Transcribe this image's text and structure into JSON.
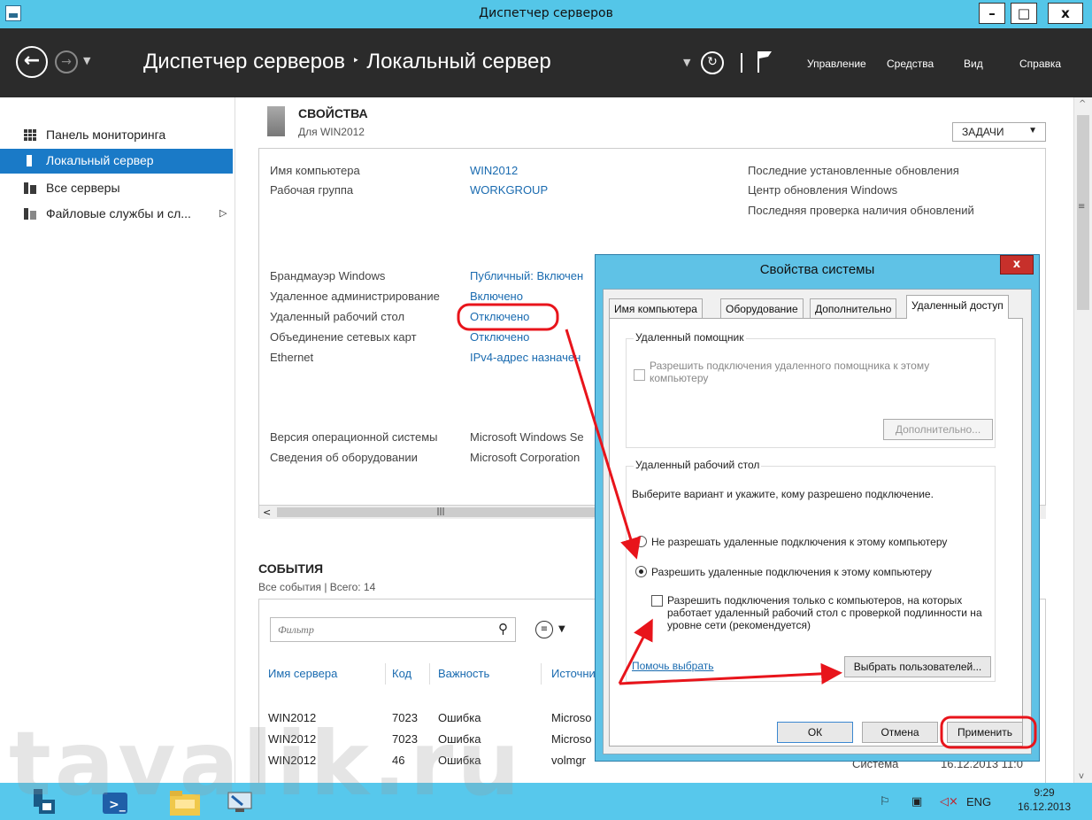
{
  "window": {
    "title": "Диспетчер серверов",
    "minimize": "–",
    "maximize": "□",
    "close": "x"
  },
  "header": {
    "breadcrumb_root": "Диспетчер серверов",
    "breadcrumb_sep": "‣",
    "breadcrumb_page": "Локальный сервер",
    "menu": [
      "Управление",
      "Средства",
      "Вид",
      "Справка"
    ]
  },
  "sidebar": {
    "items": [
      {
        "label": "Панель мониторинга"
      },
      {
        "label": "Локальный сервер"
      },
      {
        "label": "Все серверы"
      },
      {
        "label": "Файловые службы и сл..."
      }
    ]
  },
  "properties": {
    "title": "СВОЙСТВА",
    "subtitle": "Для WIN2012",
    "tasks": "ЗАДАЧИ",
    "rows1": [
      {
        "label": "Имя компьютера",
        "value": "WIN2012"
      },
      {
        "label": "Рабочая группа",
        "value": "WORKGROUP"
      }
    ],
    "right_labels": [
      "Последние установленные обновления",
      "Центр обновления Windows",
      "Последняя проверка наличия обновлений"
    ],
    "rows2": [
      {
        "label": "Брандмауэр Windows",
        "value": "Публичный: Включен"
      },
      {
        "label": "Удаленное администрирование",
        "value": "Включено"
      },
      {
        "label": "Удаленный рабочий стол",
        "value": "Отключено"
      },
      {
        "label": "Объединение сетевых карт",
        "value": "Отключено"
      },
      {
        "label": "Ethernet",
        "value": "IPv4-адрес назначен"
      }
    ],
    "rows3": [
      {
        "label": "Версия операционной системы",
        "value": "Microsoft Windows Se"
      },
      {
        "label": "Сведения об оборудовании",
        "value": "Microsoft Corporation"
      }
    ]
  },
  "events": {
    "title": "СОБЫТИЯ",
    "subtitle": "Все события | Всего: 14",
    "filter_placeholder": "Фильтр",
    "columns": [
      "Имя сервера",
      "Код",
      "Важность",
      "Источни"
    ],
    "rows": [
      {
        "server": "WIN2012",
        "code": "7023",
        "severity": "Ошибка",
        "source": "Microso"
      },
      {
        "server": "WIN2012",
        "code": "7023",
        "severity": "Ошибка",
        "source": "Microso"
      },
      {
        "server": "WIN2012",
        "code": "46",
        "severity": "Ошибка",
        "source": "volmgr",
        "log": "Система",
        "date": "16.12.2013 11:0"
      }
    ]
  },
  "dialog": {
    "title": "Свойства системы",
    "close": "x",
    "tabs": [
      "Имя компьютера",
      "Оборудование",
      "Дополнительно",
      "Удаленный доступ"
    ],
    "assist_group": "Удаленный помощник",
    "assist_check": "Разрешить подключения удаленного помощника к этому компьютеру",
    "assist_advanced": "Дополнительно...",
    "rdp_group": "Удаленный рабочий стол",
    "rdp_desc": "Выберите вариант и укажите, кому разрешено подключение.",
    "rdp_opt_deny": "Не разрешать удаленные подключения к этому компьютеру",
    "rdp_opt_allow": "Разрешить удаленные подключения к этому компьютеру",
    "rdp_nla": "Разрешить подключения только с компьютеров, на которых работает удаленный рабочий стол с проверкой подлинности на уровне сети (рекомендуется)",
    "help_link": "Помочь выбрать",
    "select_users": "Выбрать пользователей...",
    "ok": "ОК",
    "cancel": "Отмена",
    "apply": "Применить"
  },
  "taskbar": {
    "lang": "ENG",
    "time": "9:29",
    "date": "16.12.2013"
  },
  "watermark": "tavalik.ru",
  "colors": {
    "accent": "#1a7ac7",
    "titlebar": "#54c6e8",
    "header": "#2b2b2b",
    "link": "#1a6bb0",
    "annotation": "#e8141b"
  }
}
